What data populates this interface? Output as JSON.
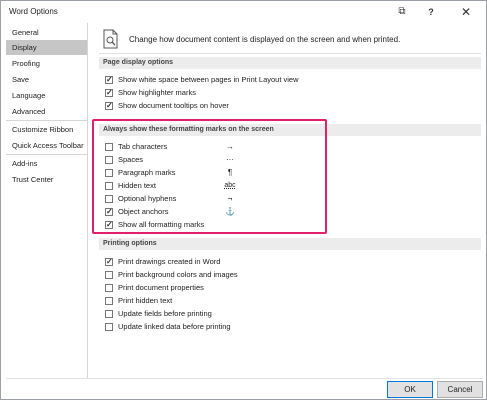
{
  "window": {
    "title": "Word Options"
  },
  "titlebar": {
    "restore_glyph": "⧉",
    "help_glyph": "?",
    "close_glyph": "✕"
  },
  "sidebar": {
    "items": [
      {
        "label": "General"
      },
      {
        "label": "Display",
        "active": true
      },
      {
        "label": "Proofing"
      },
      {
        "label": "Save"
      },
      {
        "label": "Language"
      },
      {
        "label": "Advanced"
      },
      {
        "label": "Customize Ribbon"
      },
      {
        "label": "Quick Access Toolbar"
      },
      {
        "label": "Add-ins"
      },
      {
        "label": "Trust Center"
      }
    ]
  },
  "header": {
    "text": "Change how document content is displayed on the screen and when printed."
  },
  "page_display": {
    "title": "Page display options",
    "options": [
      {
        "label": "Show white space between pages in Print Layout view",
        "checked": true
      },
      {
        "label": "Show highlighter marks",
        "checked": true
      },
      {
        "label": "Show document tooltips on hover",
        "checked": true
      }
    ]
  },
  "formatting_marks": {
    "title": "Always show these formatting marks on the screen",
    "options": [
      {
        "label": "Tab characters",
        "glyph": "→",
        "checked": false
      },
      {
        "label": "Spaces",
        "glyph": "···",
        "checked": false
      },
      {
        "label": "Paragraph marks",
        "glyph": "¶",
        "checked": false
      },
      {
        "label": "Hidden text",
        "glyph": "abc",
        "checked": false
      },
      {
        "label": "Optional hyphens",
        "glyph": "¬",
        "checked": false
      },
      {
        "label": "Object anchors",
        "glyph": "⚓",
        "checked": true
      },
      {
        "label": "Show all formatting marks",
        "glyph": "",
        "checked": true
      }
    ]
  },
  "printing": {
    "title": "Printing options",
    "options": [
      {
        "label": "Print drawings created in Word",
        "checked": true
      },
      {
        "label": "Print background colors and images",
        "checked": false
      },
      {
        "label": "Print document properties",
        "checked": false
      },
      {
        "label": "Print hidden text",
        "checked": false
      },
      {
        "label": "Update fields before printing",
        "checked": false
      },
      {
        "label": "Update linked data before printing",
        "checked": false
      }
    ]
  },
  "footer": {
    "ok_label": "OK",
    "cancel_label": "Cancel"
  },
  "colors": {
    "highlight_border": "#e0206a",
    "active_item_bg": "#c6c6c6",
    "section_bg": "#ececec"
  }
}
